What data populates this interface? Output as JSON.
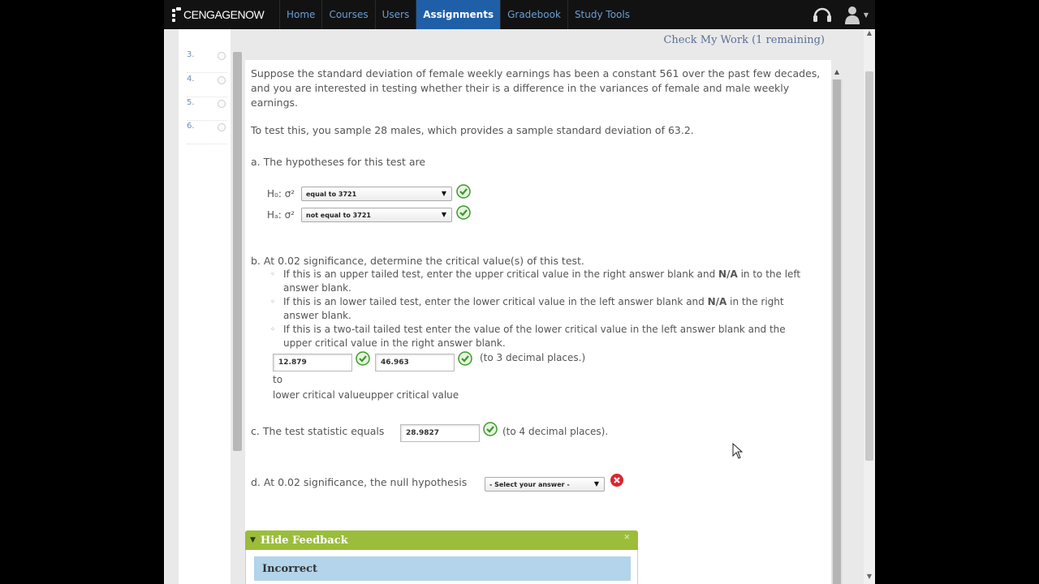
{
  "nav": {
    "logo": "CENGAGENOW",
    "items": [
      {
        "label": "Home"
      },
      {
        "label": "Courses"
      },
      {
        "label": "Users"
      },
      {
        "label": "Assignments",
        "active": true
      },
      {
        "label": "Gradebook"
      },
      {
        "label": "Study Tools"
      }
    ],
    "support_icon": "headset-icon",
    "user_icon": "user-icon"
  },
  "sidebar": {
    "items": [
      {
        "label": "3."
      },
      {
        "label": "4."
      },
      {
        "label": "5."
      },
      {
        "label": "6."
      }
    ]
  },
  "header": {
    "check_link": "Check My Work (1 remaining)"
  },
  "question": {
    "intro_1": "Suppose the standard deviation of female weekly earnings has been a constant 561 over the past few decades, and you are interested in testing whether their is a difference in the variances of female and male weekly earnings.",
    "intro_2": "To test this, you sample 28 males, which provides a sample standard deviation of 63.2.",
    "part_a": {
      "label": "a.  The hypotheses for this test are",
      "h0_label": "H₀: σ²",
      "h0_value": "equal to 3721",
      "ha_label": "Hₐ: σ²",
      "ha_value": "not equal to 3721"
    },
    "part_b": {
      "label": "b.  At 0.02 significance, determine the critical value(s) of this test.",
      "bullet_1_pre": "If this is an upper tailed test, enter the upper critical value in the right answer blank and ",
      "bullet_1_bold": "N/A",
      "bullet_1_post": " in to the left answer blank.",
      "bullet_2_pre": "If this is an lower tailed test, enter the lower critical value in the left answer blank and ",
      "bullet_2_bold": "N/A",
      "bullet_2_post": " in the right answer blank.",
      "bullet_3": "If this is a two-tail tailed test enter the value of the lower critical value in the left answer blank and the upper critical value in the right answer blank.",
      "lower_value": "12.879",
      "upper_value": "46.963",
      "precision_note": "(to 3 decimal places.)",
      "to_label": "to",
      "caption": "lower critical valueupper critical value"
    },
    "part_c": {
      "label": "c.  The test statistic equals",
      "value": "28.9827",
      "precision_note": "(to 4 decimal places)."
    },
    "part_d": {
      "label": "d.  At 0.02 significance, the null hypothesis",
      "select_value": "- Select your answer -"
    }
  },
  "feedback": {
    "toggle_label": "Hide Feedback",
    "status": "Incorrect"
  },
  "colors": {
    "nav_active": "#1f5fa8",
    "nav_link": "#6a9fd6",
    "correct": "#3a9a2a",
    "incorrect": "#d9262e",
    "feedback_bar": "#9bbd3a",
    "feedback_box": "#b3d4ea"
  }
}
